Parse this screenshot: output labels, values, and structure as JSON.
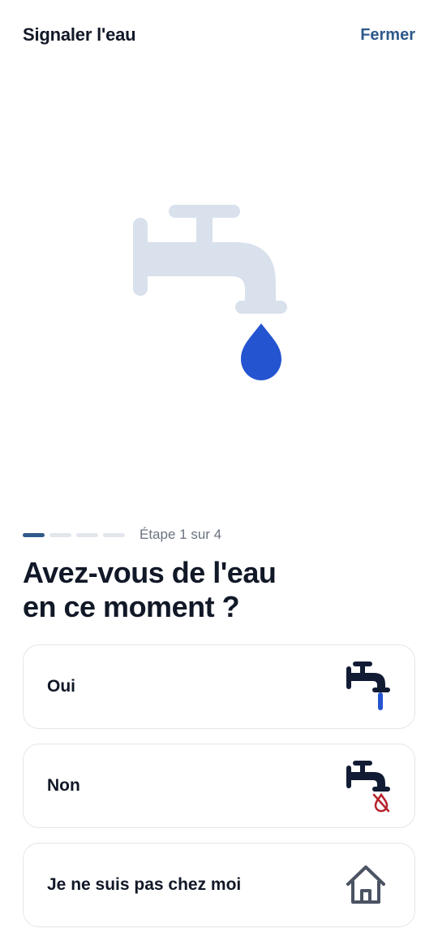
{
  "header": {
    "title": "Signaler l'eau",
    "close_label": "Fermer"
  },
  "progress": {
    "current_step": 1,
    "total_steps": 4,
    "label": "Étape 1 sur 4"
  },
  "question": {
    "line1": "Avez-vous de l'eau",
    "line2": "en ce moment ?"
  },
  "options": [
    {
      "label": "Oui",
      "icon": "faucet-running-icon"
    },
    {
      "label": "Non",
      "icon": "faucet-no-water-icon"
    },
    {
      "label": "Je ne suis pas chez moi",
      "icon": "house-icon"
    }
  ],
  "colors": {
    "accent": "#2f5a8a",
    "faucet_light": "#d8e1ec",
    "faucet_dark": "#111b33",
    "water_blue": "#2454cf",
    "alert_red": "#b4232a"
  }
}
